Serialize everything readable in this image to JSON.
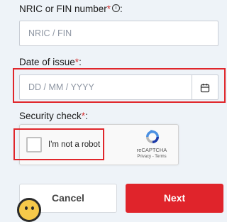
{
  "form": {
    "nric": {
      "label": "NRIC or FIN number",
      "required_mark": "*",
      "trailing_colon": ":",
      "info_glyph": "i",
      "placeholder": "NRIC / FIN"
    },
    "date_of_issue": {
      "label": "Date of issue",
      "required_mark": "*",
      "trailing_colon": ":",
      "placeholder": "DD / MM / YYYY",
      "icon": "calendar-icon"
    },
    "security_check": {
      "label": "Security check",
      "required_mark": "*",
      "trailing_colon": ":"
    }
  },
  "recaptcha": {
    "checkbox_label": "I'm not a robot",
    "brand": "reCAPTCHA",
    "links": "Privacy - Terms",
    "checked": false
  },
  "actions": {
    "cancel_label": "Cancel",
    "next_label": "Next"
  },
  "colors": {
    "accent_red": "#e0242b",
    "required_red": "#d32f2f",
    "background": "#eef3f8",
    "highlight_border": "#e0262b"
  },
  "chatbot": {
    "icon": "chatbot-avatar-icon"
  }
}
